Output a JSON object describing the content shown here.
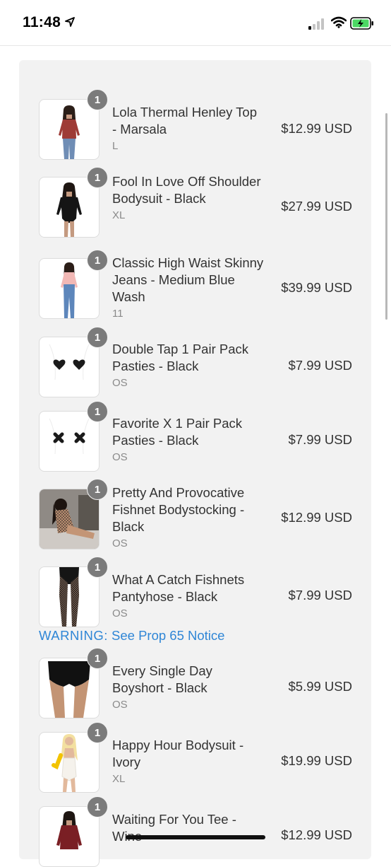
{
  "status_bar": {
    "time": "11:48"
  },
  "items": [
    {
      "qty": "1",
      "name": "Lola Thermal Henley Top - Marsala",
      "variant": "L",
      "price": "$12.99 USD",
      "image": "woman-in-marsala-henley-top"
    },
    {
      "qty": "1",
      "name": "Fool In Love Off Shoulder Bodysuit - Black",
      "variant": "XL",
      "price": "$27.99 USD",
      "image": "woman-in-black-bodysuit"
    },
    {
      "qty": "1",
      "name": "Classic High Waist Skinny Jeans - Medium Blue Wash",
      "variant": "11",
      "price": "$39.99 USD",
      "image": "woman-in-blue-jeans"
    },
    {
      "qty": "1",
      "name": "Double Tap 1 Pair Pack Pasties - Black",
      "variant": "OS",
      "price": "$7.99 USD",
      "image": "heart-pasties"
    },
    {
      "qty": "1",
      "name": "Favorite X 1 Pair Pack Pasties - Black",
      "variant": "OS",
      "price": "$7.99 USD",
      "image": "x-pasties"
    },
    {
      "qty": "1",
      "name": "Pretty And Provocative Fishnet Bodystocking - Black",
      "variant": "OS",
      "price": "$12.99 USD",
      "image": "woman-in-fishnet-bodystocking"
    },
    {
      "qty": "1",
      "name": "What A Catch Fishnets Pantyhose - Black",
      "variant": "OS",
      "price": "$7.99 USD",
      "image": "fishnet-pantyhose-legs"
    },
    {
      "qty": "1",
      "name": "Every Single Day Boyshort - Black",
      "variant": "OS",
      "price": "$5.99 USD",
      "image": "black-boyshort"
    },
    {
      "qty": "1",
      "name": "Happy Hour Bodysuit - Ivory",
      "variant": "XL",
      "price": "$19.99 USD",
      "image": "woman-in-ivory-bodysuit"
    },
    {
      "qty": "1",
      "name": "Waiting For You Tee - Wine",
      "variant": "",
      "price": "$12.99 USD",
      "image": "woman-in-wine-tee"
    }
  ],
  "warning": {
    "prefix": "WARNING:",
    "link": "See Prop 65 Notice"
  },
  "colors": {
    "accent_link": "#2f86d6",
    "qty_badge": "#7b7b7b",
    "panel_bg": "#f2f2f2"
  }
}
